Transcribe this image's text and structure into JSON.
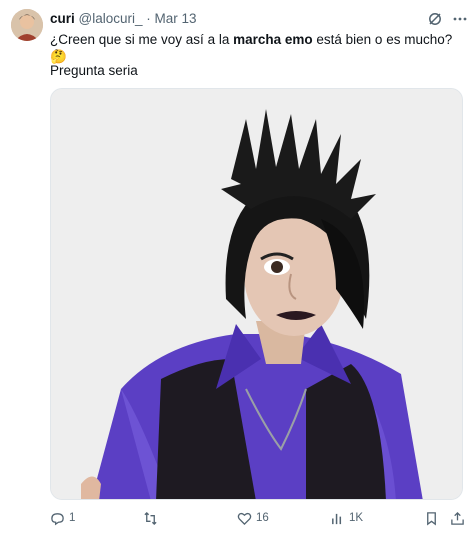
{
  "tweet": {
    "author_name": "curi",
    "author_handle": "@lalocuri_",
    "date": "Mar 13",
    "separator": "·",
    "text_pre": "¿Creen que si me voy así a la ",
    "text_bold": "marcha emo",
    "text_post": " está bien o es mucho? 🤔",
    "text_line2": "Pregunta seria"
  },
  "actions": {
    "replies": "1",
    "likes": "16",
    "views": "1K"
  },
  "icons": [
    "avatar",
    "grok-icon",
    "more-icon",
    "reply-icon",
    "retweet-icon",
    "like-icon",
    "views-icon",
    "bookmark-icon",
    "share-icon"
  ],
  "colors": {
    "text": "#0f1419",
    "secondary": "#536471",
    "purple_shirt": "#5b3fc4"
  }
}
